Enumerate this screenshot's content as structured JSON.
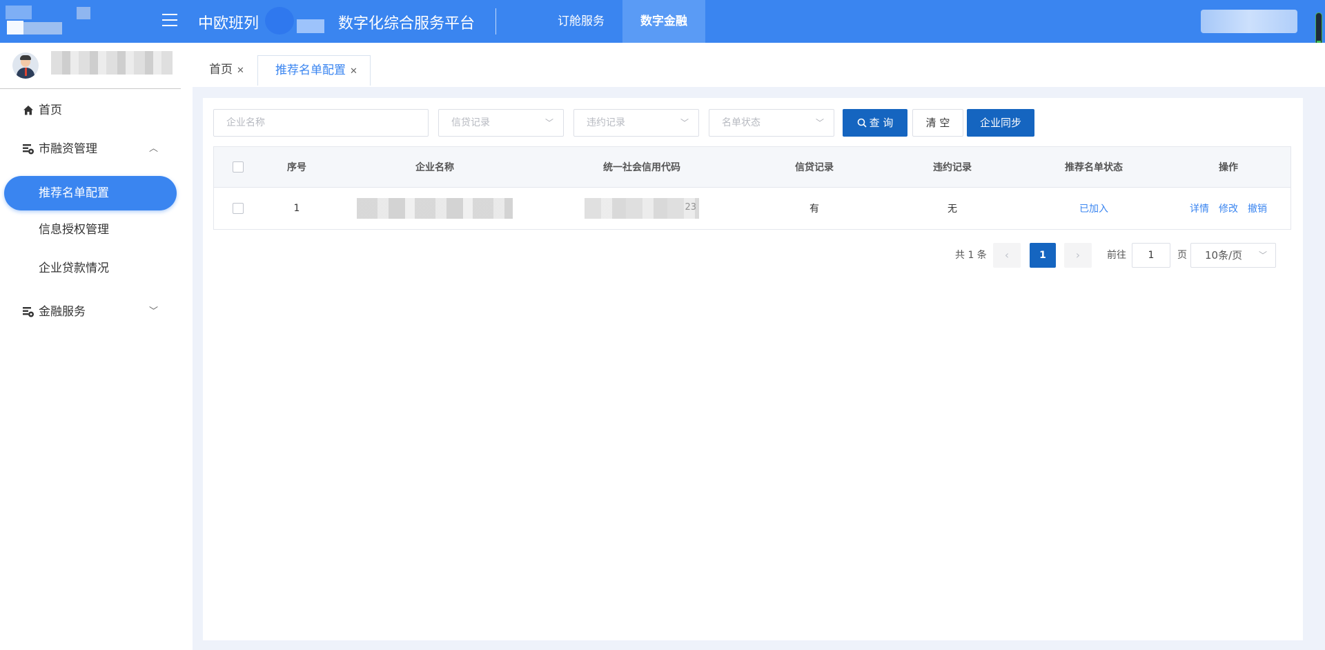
{
  "header": {
    "title_prefix": "中欧班列",
    "title_suffix": "数字化综合服务平台",
    "nav": [
      {
        "label": "订舱服务",
        "active": false
      },
      {
        "label": "数字金融",
        "active": true
      }
    ],
    "accent_color": "#3a85f0"
  },
  "sidebar": {
    "menu": {
      "home": "首页",
      "group1": "市融资管理",
      "sub_items": [
        "推荐名单配置",
        "信息授权管理",
        "企业贷款情况"
      ],
      "group2": "金融服务"
    },
    "icons": {
      "home": "home-icon",
      "group1": "finance-settings-icon",
      "group2": "finance-settings-icon"
    }
  },
  "tabs": [
    {
      "label": "首页",
      "active": false
    },
    {
      "label": "推荐名单配置",
      "active": true
    }
  ],
  "filters": {
    "company_name_placeholder": "企业名称",
    "credit_record_placeholder": "信贷记录",
    "violation_record_placeholder": "违约记录",
    "list_status_placeholder": "名单状态",
    "query_label": "查 询",
    "clear_label": "清 空",
    "sync_label": "企业同步"
  },
  "table": {
    "columns": [
      "序号",
      "企业名称",
      "统一社会信用代码",
      "信贷记录",
      "违约记录",
      "推荐名单状态",
      "操作"
    ],
    "rows": [
      {
        "index": "1",
        "credit_code_tail": "23",
        "credit_record": "有",
        "violation_record": "无",
        "status": "已加入",
        "actions": [
          "详情",
          "修改",
          "撤销"
        ]
      }
    ]
  },
  "pagination": {
    "total_text": "共 1 条",
    "current_page": "1",
    "goto_label": "前往",
    "goto_value": "1",
    "page_label": "页",
    "page_size": "10条/页"
  }
}
